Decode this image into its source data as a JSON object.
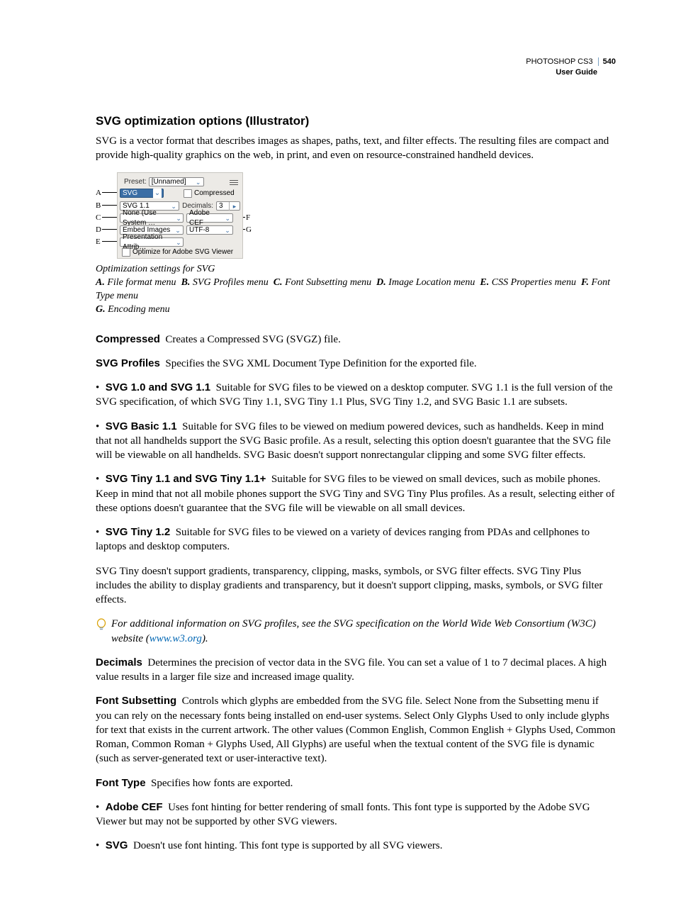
{
  "header": {
    "product": "PHOTOSHOP CS3",
    "page_number": "540",
    "doc_title": "User Guide"
  },
  "section_title": "SVG optimization options (Illustrator)",
  "intro": "SVG is a vector format that describes images as shapes, paths, text, and filter effects. The resulting files are compact and provide high-quality graphics on the web, in print, and even on resource-constrained handheld devices.",
  "figure": {
    "preset_label": "Preset:",
    "preset_value": "[Unnamed]",
    "format_value": "SVG",
    "compressed_label": "Compressed",
    "profiles_value": "SVG 1.1",
    "decimals_label": "Decimals:",
    "decimals_value": "3",
    "subsetting_value": "None (Use System …",
    "fonttype_value": "Adobe CEF",
    "imageloc_value": "Embed Images",
    "encoding_value": "UTF-8",
    "cssprops_value": "Presentation Attrib…",
    "optimize_label": "Optimize for Adobe SVG Viewer"
  },
  "callouts": {
    "A": "A",
    "B": "B",
    "C": "C",
    "D": "D",
    "E": "E",
    "F": "F",
    "G": "G"
  },
  "caption": {
    "title": "Optimization settings for SVG",
    "items": {
      "A": "File format menu",
      "B": "SVG Profiles menu",
      "C": "Font Subsetting menu",
      "D": "Image Location menu",
      "E": "CSS Properties menu",
      "F": "Font Type menu",
      "G": "Encoding menu"
    }
  },
  "defs": {
    "compressed": {
      "term": "Compressed",
      "body": "Creates a Compressed SVG (SVGZ) file."
    },
    "svg_profiles": {
      "term": "SVG Profiles",
      "body": "Specifies the SVG XML Document Type Definition for the exported file."
    },
    "p1": {
      "term": "SVG 1.0 and SVG 1.1",
      "body": "Suitable for SVG files to be viewed on a desktop computer. SVG 1.1 is the full version of the SVG specification, of which SVG Tiny 1.1, SVG Tiny 1.1 Plus, SVG Tiny 1.2, and SVG Basic 1.1 are subsets."
    },
    "p2": {
      "term": "SVG Basic 1.1",
      "body": "Suitable for SVG files to be viewed on medium powered devices, such as handhelds. Keep in mind that not all handhelds support the SVG Basic profile. As a result, selecting this option doesn't guarantee that the SVG file will be viewable on all handhelds. SVG Basic doesn't support nonrectangular clipping and some SVG filter effects."
    },
    "p3": {
      "term": "SVG Tiny 1.1 and SVG Tiny 1.1+",
      "body": "Suitable for SVG files to be viewed on small devices, such as mobile phones. Keep in mind that not all mobile phones support the SVG Tiny and SVG Tiny Plus profiles. As a result, selecting either of these options doesn't guarantee that the SVG file will be viewable on all small devices."
    },
    "p4": {
      "term": "SVG Tiny 1.2",
      "body": "Suitable for SVG files to be viewed on a variety of devices ranging from PDAs and cellphones to laptops and desktop computers."
    },
    "tiny_note": "SVG Tiny doesn't support gradients, transparency, clipping, masks, symbols, or SVG filter effects. SVG Tiny Plus includes the ability to display gradients and transparency, but it doesn't support clipping, masks, symbols, or SVG filter effects.",
    "tip_pre": "For additional information on SVG profiles, see the SVG specification on the World Wide Web Consortium (W3C) website (",
    "tip_link": "www.w3.org",
    "tip_post": ").",
    "decimals": {
      "term": "Decimals",
      "body": "Determines the precision of vector data in the SVG file. You can set a value of 1 to 7 decimal places. A high value results in a larger file size and increased image quality."
    },
    "font_subsetting": {
      "term": "Font Subsetting",
      "body": "Controls which glyphs are embedded from the SVG file. Select None from the Subsetting menu if you can rely on the necessary fonts being installed on end-user systems. Select Only Glyphs Used to only include glyphs for text that exists in the current artwork. The other values (Common English, Common English + Glyphs Used, Common Roman, Common Roman + Glyphs Used, All Glyphs) are useful when the textual content of the SVG file is dynamic (such as server-generated text or user-interactive text)."
    },
    "font_type": {
      "term": "Font Type",
      "body": "Specifies how fonts are exported."
    },
    "ft1": {
      "term": "Adobe CEF",
      "body": "Uses font hinting for better rendering of small fonts. This font type is supported by the Adobe SVG Viewer but may not be supported by other SVG viewers."
    },
    "ft2": {
      "term": "SVG",
      "body": "Doesn't use font hinting. This font type is supported by all SVG viewers."
    }
  }
}
